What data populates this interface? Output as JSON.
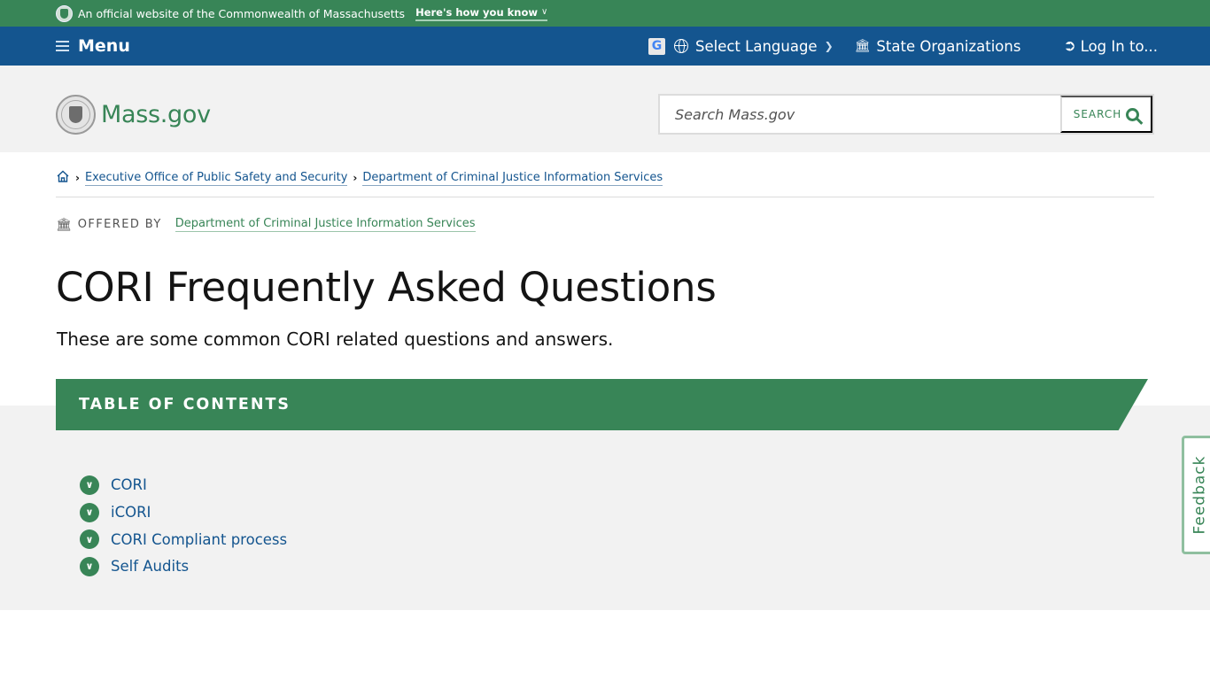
{
  "banner": {
    "official_text": "An official website of the Commonwealth of Massachusetts",
    "how_you_know": "Here's how you know"
  },
  "nav": {
    "menu_label": "Menu",
    "language_label": "Select Language",
    "state_orgs_label": "State Organizations",
    "login_label": "Log In to..."
  },
  "header": {
    "logo_text": "Mass.gov",
    "search_placeholder": "Search Mass.gov",
    "search_button": "SEARCH"
  },
  "breadcrumb": {
    "items": [
      {
        "label": "Executive Office of Public Safety and Security"
      },
      {
        "label": "Department of Criminal Justice Information Services"
      }
    ]
  },
  "offered_by": {
    "label": "OFFERED BY",
    "org": "Department of Criminal Justice Information Services"
  },
  "page": {
    "title": "CORI Frequently Asked Questions",
    "subtitle": "These are some common CORI related questions and answers."
  },
  "toc": {
    "title": "TABLE OF CONTENTS",
    "items": [
      {
        "label": "CORI"
      },
      {
        "label": "iCORI"
      },
      {
        "label": "CORI Compliant process"
      },
      {
        "label": "Self Audits"
      }
    ]
  },
  "feedback": {
    "label": "Feedback"
  },
  "colors": {
    "brand_green": "#388557",
    "nav_blue": "#14558f",
    "link_blue": "#14558f",
    "light_gray": "#f2f2f2"
  }
}
